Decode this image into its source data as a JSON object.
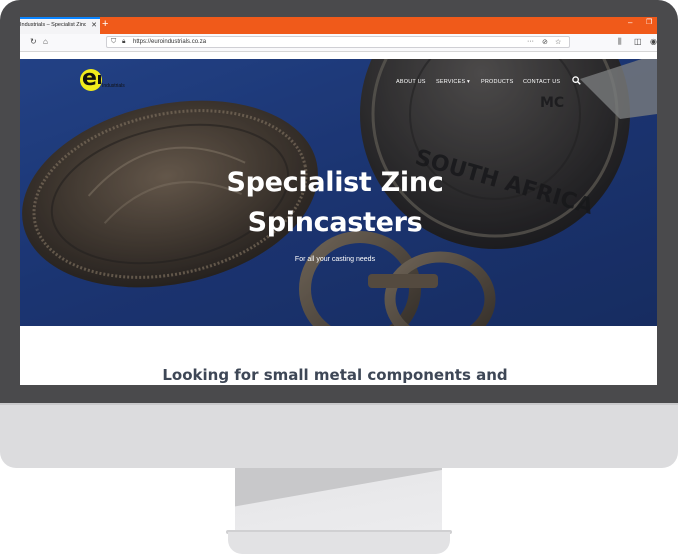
{
  "browser": {
    "tab_title": "Industrials – Specialist Zinc",
    "tab_close": "✕",
    "new_tab": "+",
    "window_minimize": "–",
    "window_restore": "❐",
    "url": "https://euroindustrials.co.za",
    "page_actions": "···"
  },
  "site": {
    "logo_letter": "e",
    "logo_text": "Industrials",
    "nav_items": [
      "ABOUT US",
      "SERVICES ▾",
      "PRODUCTS",
      "CONTACT US"
    ]
  },
  "hero": {
    "title_line1": "Specialist Zinc",
    "title_line2": "Spincasters",
    "subtitle": "For all your casting needs"
  },
  "section": {
    "heading": "Looking for small metal components and"
  },
  "colors": {
    "tab_bar": "#f05a1a",
    "hero_blue": "#1f3f83",
    "logo_yellow": "#f2ec1c",
    "heading_text": "#3e4756",
    "monitor_bezel": "#4a4a4c"
  }
}
